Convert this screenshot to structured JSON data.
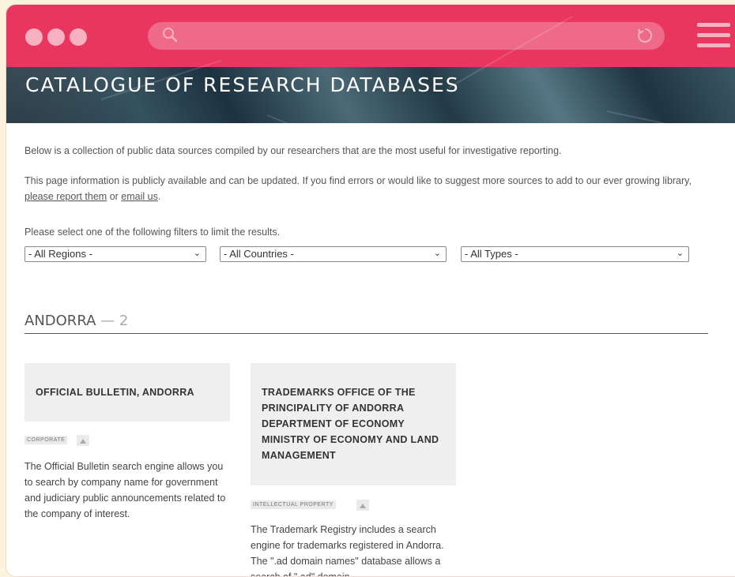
{
  "browser": {
    "dot_color": "#f7b2c2",
    "bar_color": "#e8365f",
    "search_icon": "search-icon",
    "reload_icon": "reload-icon",
    "menu_icon": "hamburger-menu-icon"
  },
  "hero": {
    "title": "CATALOGUE OF RESEARCH DATABASES"
  },
  "intro": {
    "line1": "Below is a collection of public data sources compiled by our researchers that are the most useful for investigative reporting.",
    "line2_start": "This page information is publicly available and can be updated. If you find errors or would like to suggest more sources to add to our ever growing library, ",
    "link_report": "please report them",
    "line2_mid": " or ",
    "link_email": "email us",
    "line2_end": ".",
    "filter_prompt": "Please select one of the following filters to limit the results."
  },
  "filters": {
    "regions": "- All Regions -",
    "countries": "- All Countries -",
    "types": "- All Types -"
  },
  "section": {
    "name": "ANDORRA",
    "separator": " — ",
    "count": "2"
  },
  "cards": [
    {
      "title": "OFFICIAL BULLETIN, ANDORRA",
      "tag": "CORPORATE",
      "tag_icon": "building-icon",
      "description": "The Official Bulletin search engine allows you to search by company name for government and judiciary public announcements related to the company of interest."
    },
    {
      "title": "TRADEMARKS OFFICE OF THE PRINCIPALITY OF ANDORRA DEPARTMENT OF ECONOMY MINISTRY OF ECONOMY AND LAND MANAGEMENT",
      "tag": "INTELLECTUAL PROPERTY",
      "tag_icon": "building-icon",
      "description": "The Trademark Registry includes a search engine for trademarks registered in Andorra. The \".ad domain names\" database allows a search of \".ad\" domain"
    }
  ]
}
